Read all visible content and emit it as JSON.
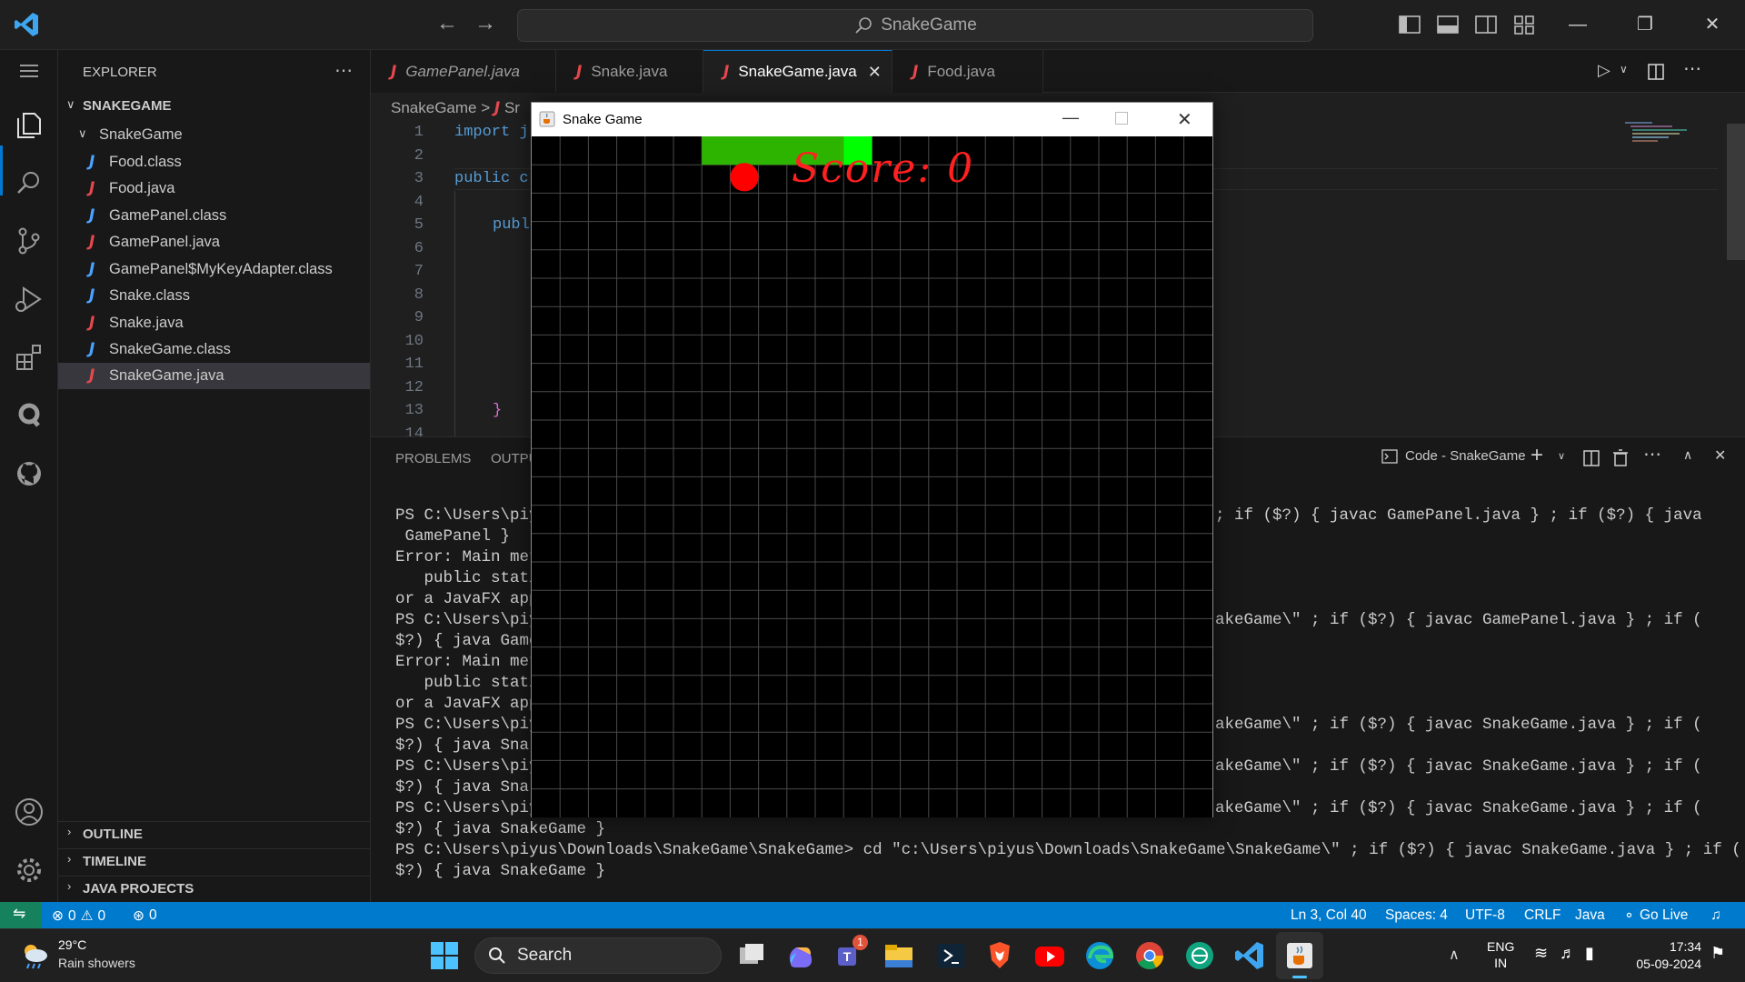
{
  "titlebar": {
    "search_text": "SnakeGame"
  },
  "sidebar": {
    "explorer_label": "EXPLORER",
    "root_folder": "SNAKEGAME",
    "sub_folder": "SnakeGame",
    "files": [
      {
        "name": "Food.class",
        "type": "class"
      },
      {
        "name": "Food.java",
        "type": "java"
      },
      {
        "name": "GamePanel.class",
        "type": "class"
      },
      {
        "name": "GamePanel.java",
        "type": "java"
      },
      {
        "name": "GamePanel$MyKeyAdapter.class",
        "type": "class"
      },
      {
        "name": "Snake.class",
        "type": "class"
      },
      {
        "name": "Snake.java",
        "type": "java"
      },
      {
        "name": "SnakeGame.class",
        "type": "class"
      },
      {
        "name": "SnakeGame.java",
        "type": "java",
        "selected": true
      }
    ],
    "outline": "OUTLINE",
    "timeline": "TIMELINE",
    "java_projects": "JAVA PROJECTS"
  },
  "tabs": [
    {
      "label": "GamePanel.java",
      "italic": true
    },
    {
      "label": "Snake.java"
    },
    {
      "label": "SnakeGame.java",
      "active": true
    },
    {
      "label": "Food.java"
    }
  ],
  "breadcrumb": {
    "folder": "SnakeGame",
    "separator": ">",
    "file_fragment": "Sr"
  },
  "editor": {
    "line_numbers": [
      "1",
      "2",
      "3",
      "4",
      "5",
      "6",
      "7",
      "8",
      "9",
      "10",
      "11",
      "12",
      "13",
      "14"
    ],
    "line1": "import j",
    "line3": "public c",
    "line5": "publ",
    "line13": "}"
  },
  "panel": {
    "tab_problems": "PROBLEMS",
    "tab_output": "OUTPU",
    "terminal_name": "Code - SnakeGame",
    "lines_left": [
      "PS C:\\Users\\piy",
      " GamePanel }",
      "Error: Main met",
      "   public stati",
      "or a JavaFX app",
      "PS C:\\Users\\piy",
      "$?) { java Game",
      "Error: Main met",
      "   public stati",
      "or a JavaFX app",
      "PS C:\\Users\\piy",
      "$?) { java Snak",
      "PS C:\\Users\\piy",
      "$?) { java Snak",
      "PS C:\\Users\\piy",
      "$?) { java SnakeGame }",
      "PS C:\\Users\\piyus\\Downloads\\SnakeGame\\SnakeGame> cd \"c:\\Users\\piyus\\Downloads\\SnakeGame\\SnakeGame\\\" ; if ($?) { javac SnakeGame.java } ; if (",
      "$?) { java SnakeGame }"
    ],
    "lines_right": [
      "; if ($?) { javac GamePanel.java } ; if ($?) { java",
      "akeGame\\\" ; if ($?) { javac GamePanel.java } ; if (",
      "akeGame\\\" ; if ($?) { javac SnakeGame.java } ; if (",
      "akeGame\\\" ; if ($?) { javac SnakeGame.java } ; if (",
      "akeGame\\\" ; if ($?) { javac SnakeGame.java } ; if ("
    ]
  },
  "statusbar": {
    "errors": "0",
    "warnings": "0",
    "ports": "0",
    "position": "Ln 3, Col 40",
    "spaces": "Spaces: 4",
    "encoding": "UTF-8",
    "eol": "CRLF",
    "language": "Java",
    "golive": "Go Live"
  },
  "snake_window": {
    "title": "Snake Game",
    "score_text": "Score: 0",
    "score_color": "#ff2020",
    "snake_head_color": "#00ff00",
    "snake_body_color": "#2db400",
    "food_color": "#ff0000",
    "grid_color": "#4a4a4a"
  },
  "taskbar": {
    "temperature": "29°C",
    "weather": "Rain showers",
    "search_label": "Search",
    "teams_badge": "1",
    "language_top": "ENG",
    "language_bottom": "IN",
    "time": "17:34",
    "date": "05-09-2024"
  }
}
